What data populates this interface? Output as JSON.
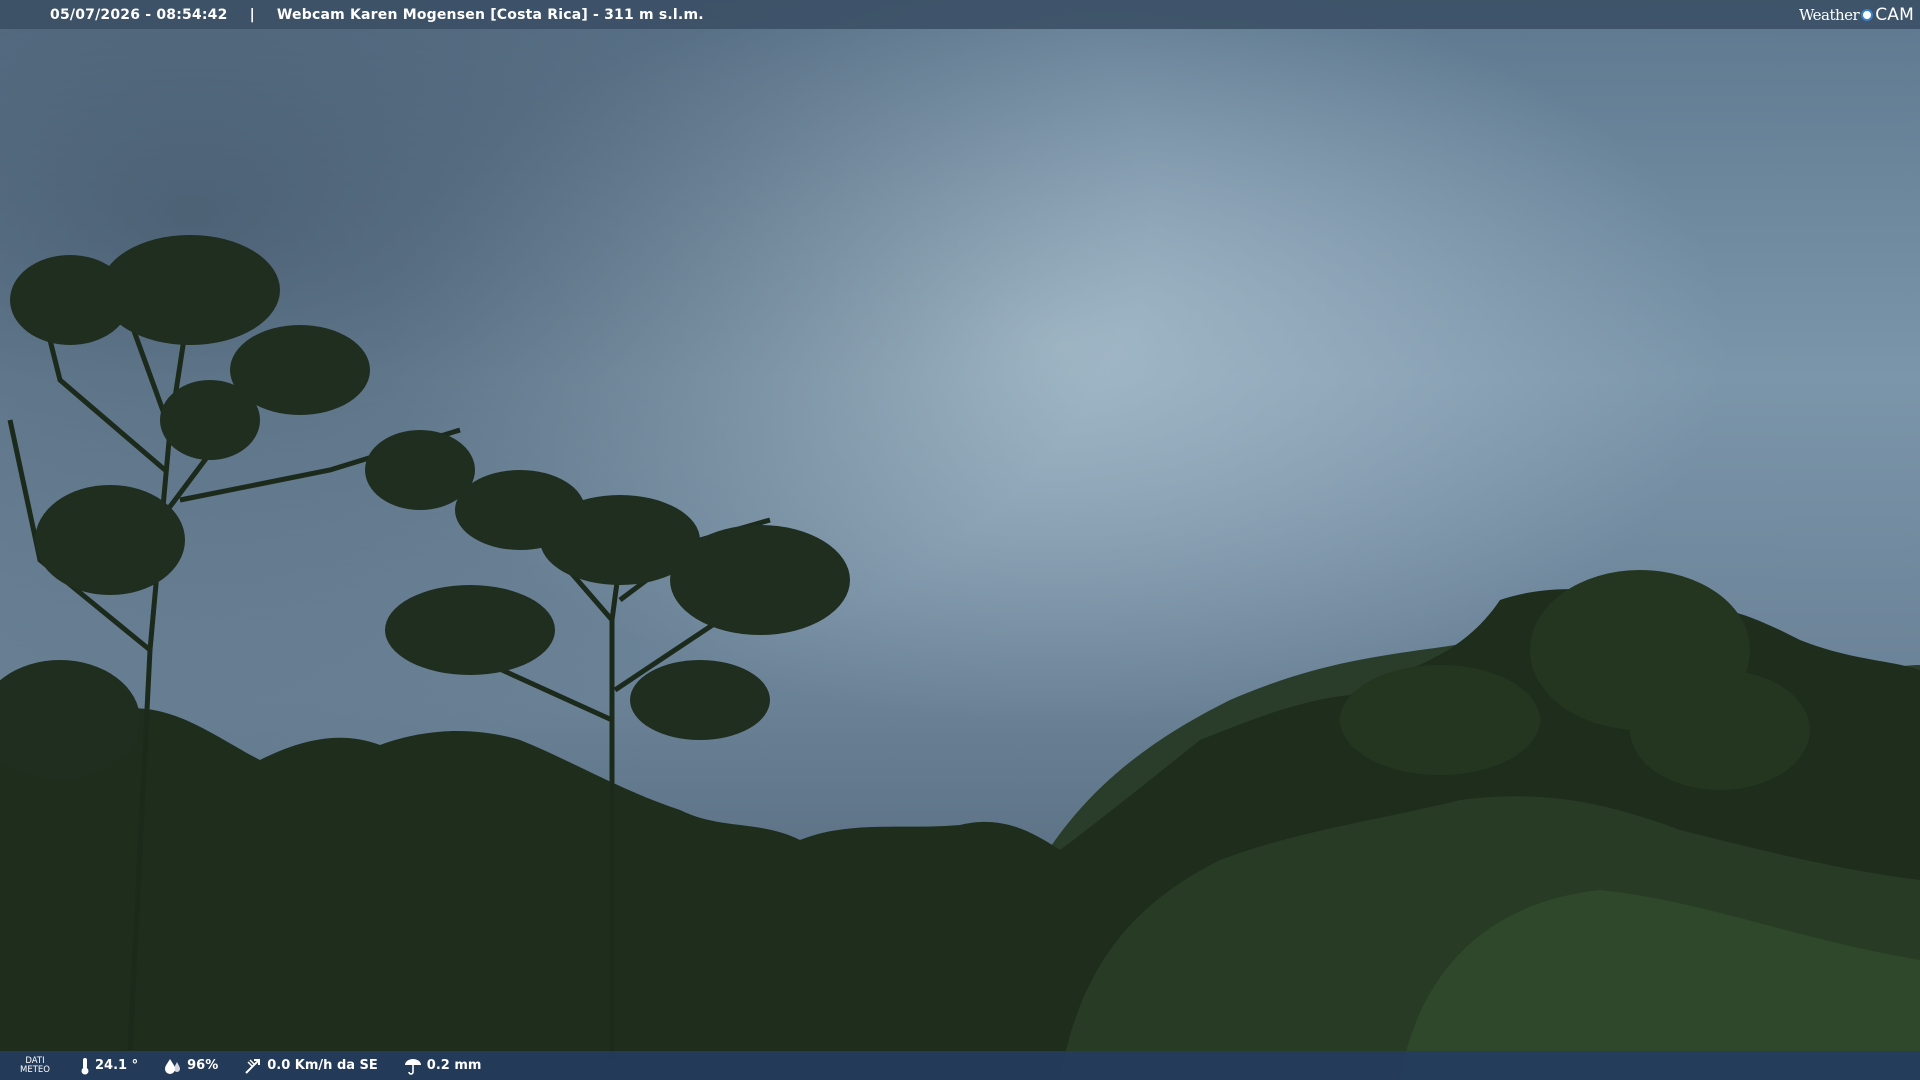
{
  "header": {
    "datetime": "05/07/2026 - 08:54:42",
    "separator": "|",
    "location": "Webcam Karen Mogensen [Costa Rica]  - 311 m s.l.m.",
    "brand_word": "Weather",
    "brand_cam": "CAM"
  },
  "footer": {
    "label_line1": "DATI",
    "label_line2": "METEO",
    "temperature": "24.1 °",
    "humidity": "96%",
    "wind": "0.0 Km/h da SE",
    "rain": "0.2 mm"
  },
  "colors": {
    "sky_top": "#647f97",
    "sky_mid": "#8ea8bb",
    "sky_low": "#4d5f71",
    "foliage": "#1d2c1c",
    "foliage_light": "#344b2c"
  },
  "icons": [
    "thermometer-icon",
    "humidity-icon",
    "wind-icon",
    "rain-icon"
  ]
}
